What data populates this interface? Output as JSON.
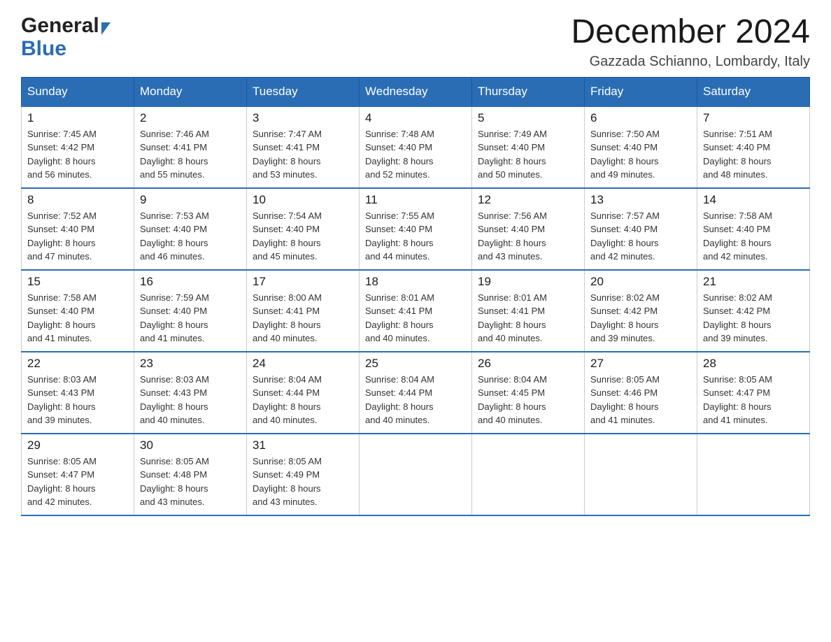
{
  "header": {
    "logo_general": "General",
    "logo_blue": "Blue",
    "title": "December 2024",
    "subtitle": "Gazzada Schianno, Lombardy, Italy"
  },
  "days_of_week": [
    "Sunday",
    "Monday",
    "Tuesday",
    "Wednesday",
    "Thursday",
    "Friday",
    "Saturday"
  ],
  "weeks": [
    [
      {
        "day": "1",
        "sunrise": "7:45 AM",
        "sunset": "4:42 PM",
        "daylight": "8 hours and 56 minutes."
      },
      {
        "day": "2",
        "sunrise": "7:46 AM",
        "sunset": "4:41 PM",
        "daylight": "8 hours and 55 minutes."
      },
      {
        "day": "3",
        "sunrise": "7:47 AM",
        "sunset": "4:41 PM",
        "daylight": "8 hours and 53 minutes."
      },
      {
        "day": "4",
        "sunrise": "7:48 AM",
        "sunset": "4:40 PM",
        "daylight": "8 hours and 52 minutes."
      },
      {
        "day": "5",
        "sunrise": "7:49 AM",
        "sunset": "4:40 PM",
        "daylight": "8 hours and 50 minutes."
      },
      {
        "day": "6",
        "sunrise": "7:50 AM",
        "sunset": "4:40 PM",
        "daylight": "8 hours and 49 minutes."
      },
      {
        "day": "7",
        "sunrise": "7:51 AM",
        "sunset": "4:40 PM",
        "daylight": "8 hours and 48 minutes."
      }
    ],
    [
      {
        "day": "8",
        "sunrise": "7:52 AM",
        "sunset": "4:40 PM",
        "daylight": "8 hours and 47 minutes."
      },
      {
        "day": "9",
        "sunrise": "7:53 AM",
        "sunset": "4:40 PM",
        "daylight": "8 hours and 46 minutes."
      },
      {
        "day": "10",
        "sunrise": "7:54 AM",
        "sunset": "4:40 PM",
        "daylight": "8 hours and 45 minutes."
      },
      {
        "day": "11",
        "sunrise": "7:55 AM",
        "sunset": "4:40 PM",
        "daylight": "8 hours and 44 minutes."
      },
      {
        "day": "12",
        "sunrise": "7:56 AM",
        "sunset": "4:40 PM",
        "daylight": "8 hours and 43 minutes."
      },
      {
        "day": "13",
        "sunrise": "7:57 AM",
        "sunset": "4:40 PM",
        "daylight": "8 hours and 42 minutes."
      },
      {
        "day": "14",
        "sunrise": "7:58 AM",
        "sunset": "4:40 PM",
        "daylight": "8 hours and 42 minutes."
      }
    ],
    [
      {
        "day": "15",
        "sunrise": "7:58 AM",
        "sunset": "4:40 PM",
        "daylight": "8 hours and 41 minutes."
      },
      {
        "day": "16",
        "sunrise": "7:59 AM",
        "sunset": "4:40 PM",
        "daylight": "8 hours and 41 minutes."
      },
      {
        "day": "17",
        "sunrise": "8:00 AM",
        "sunset": "4:41 PM",
        "daylight": "8 hours and 40 minutes."
      },
      {
        "day": "18",
        "sunrise": "8:01 AM",
        "sunset": "4:41 PM",
        "daylight": "8 hours and 40 minutes."
      },
      {
        "day": "19",
        "sunrise": "8:01 AM",
        "sunset": "4:41 PM",
        "daylight": "8 hours and 40 minutes."
      },
      {
        "day": "20",
        "sunrise": "8:02 AM",
        "sunset": "4:42 PM",
        "daylight": "8 hours and 39 minutes."
      },
      {
        "day": "21",
        "sunrise": "8:02 AM",
        "sunset": "4:42 PM",
        "daylight": "8 hours and 39 minutes."
      }
    ],
    [
      {
        "day": "22",
        "sunrise": "8:03 AM",
        "sunset": "4:43 PM",
        "daylight": "8 hours and 39 minutes."
      },
      {
        "day": "23",
        "sunrise": "8:03 AM",
        "sunset": "4:43 PM",
        "daylight": "8 hours and 40 minutes."
      },
      {
        "day": "24",
        "sunrise": "8:04 AM",
        "sunset": "4:44 PM",
        "daylight": "8 hours and 40 minutes."
      },
      {
        "day": "25",
        "sunrise": "8:04 AM",
        "sunset": "4:44 PM",
        "daylight": "8 hours and 40 minutes."
      },
      {
        "day": "26",
        "sunrise": "8:04 AM",
        "sunset": "4:45 PM",
        "daylight": "8 hours and 40 minutes."
      },
      {
        "day": "27",
        "sunrise": "8:05 AM",
        "sunset": "4:46 PM",
        "daylight": "8 hours and 41 minutes."
      },
      {
        "day": "28",
        "sunrise": "8:05 AM",
        "sunset": "4:47 PM",
        "daylight": "8 hours and 41 minutes."
      }
    ],
    [
      {
        "day": "29",
        "sunrise": "8:05 AM",
        "sunset": "4:47 PM",
        "daylight": "8 hours and 42 minutes."
      },
      {
        "day": "30",
        "sunrise": "8:05 AM",
        "sunset": "4:48 PM",
        "daylight": "8 hours and 43 minutes."
      },
      {
        "day": "31",
        "sunrise": "8:05 AM",
        "sunset": "4:49 PM",
        "daylight": "8 hours and 43 minutes."
      },
      null,
      null,
      null,
      null
    ]
  ],
  "labels": {
    "sunrise": "Sunrise:",
    "sunset": "Sunset:",
    "daylight": "Daylight:"
  }
}
